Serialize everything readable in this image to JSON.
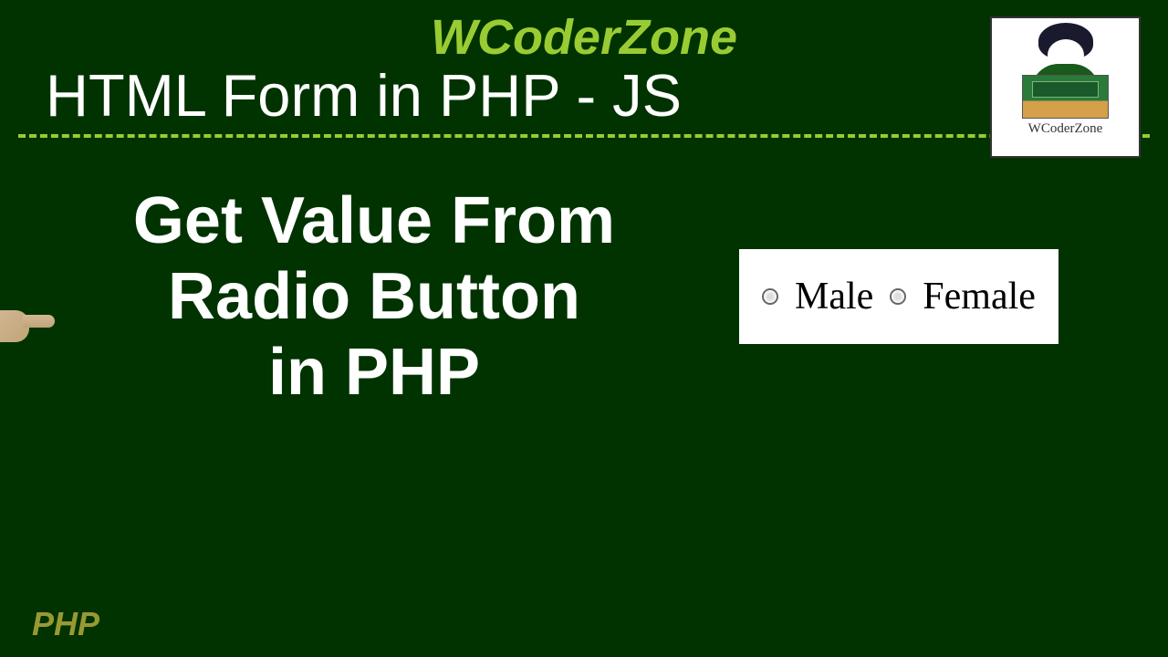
{
  "header": {
    "brand": "WCoderZone",
    "subtitle": "HTML Form in PHP - JS"
  },
  "main": {
    "topic_line1": "Get Value From",
    "topic_line2": "Radio Button",
    "topic_line3": "in PHP"
  },
  "radio_example": {
    "option1": "Male",
    "option2": "Female"
  },
  "logo": {
    "text": "WCoderZone"
  },
  "footer": {
    "label": "PHP"
  }
}
